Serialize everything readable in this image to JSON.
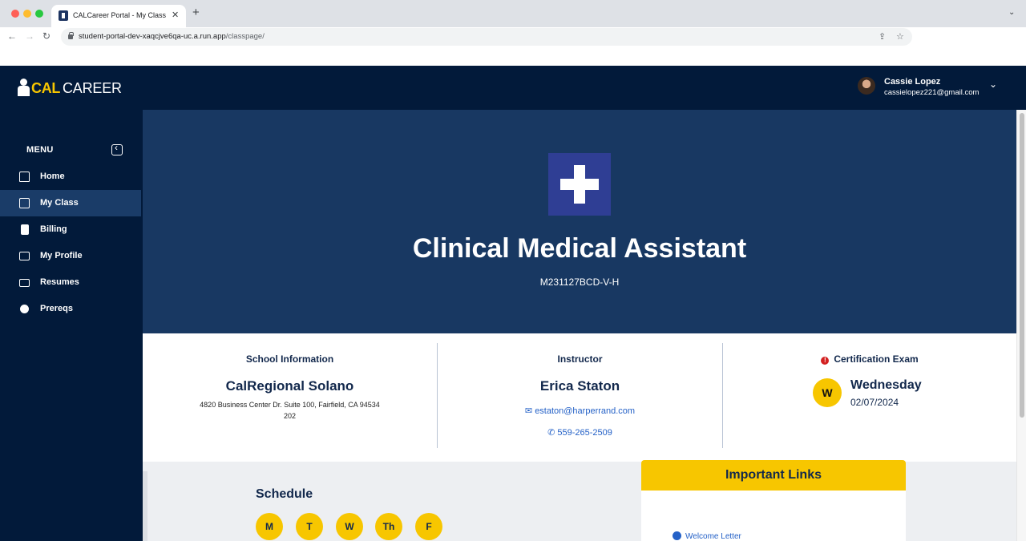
{
  "browser": {
    "tab_title": "CALCareer Portal - My Class",
    "tab_close": "✕",
    "new_tab": "+",
    "tab_menu": "⌄",
    "url_host": "student-portal-dev-xaqcjve6qa-uc.a.run.app",
    "url_path": "/classpage/",
    "back": "←",
    "forward": "→",
    "reload": "↻",
    "share": "⇪",
    "star": "☆"
  },
  "header": {
    "logo_cal": "CAL",
    "logo_career": "CAREER",
    "user_name": "Cassie Lopez",
    "user_email": "cassielopez221@gmail.com",
    "user_menu": "⌄"
  },
  "sidebar": {
    "menu_title": "MENU",
    "items": [
      {
        "label": "Home",
        "icon": "home-icon",
        "active": false
      },
      {
        "label": "My Class",
        "icon": "class-icon",
        "active": true
      },
      {
        "label": "Billing",
        "icon": "billing-icon",
        "active": false
      },
      {
        "label": "My Profile",
        "icon": "profile-icon",
        "active": false
      },
      {
        "label": "Resumes",
        "icon": "briefcase-icon",
        "active": false
      },
      {
        "label": "Prereqs",
        "icon": "check-circle-icon",
        "active": false
      }
    ]
  },
  "hero": {
    "title": "Clinical Medical Assistant",
    "code": "M231127BCD-V-H"
  },
  "school": {
    "label": "School Information",
    "name": "CalRegional Solano",
    "address_line1": "4820 Business Center Dr. Suite 100, Fairfield, CA 94534",
    "address_line2": "202"
  },
  "instructor": {
    "label": "Instructor",
    "name": "Erica Staton",
    "email": "estaton@harperrand.com",
    "phone": "559-265-2509",
    "email_icon": "✉",
    "phone_icon": "✆"
  },
  "exam": {
    "label": "Certification Exam",
    "alert_icon": "!",
    "badge": "W",
    "day": "Wednesday",
    "date": "02/07/2024"
  },
  "schedule": {
    "title": "Schedule",
    "days": [
      "M",
      "T",
      "W",
      "Th",
      "F"
    ]
  },
  "links": {
    "title": "Important Links",
    "items": [
      "Welcome Letter"
    ]
  },
  "colors": {
    "navy": "#021a3a",
    "hero": "#183862",
    "accent": "#f7c600",
    "link": "#2461c7"
  }
}
